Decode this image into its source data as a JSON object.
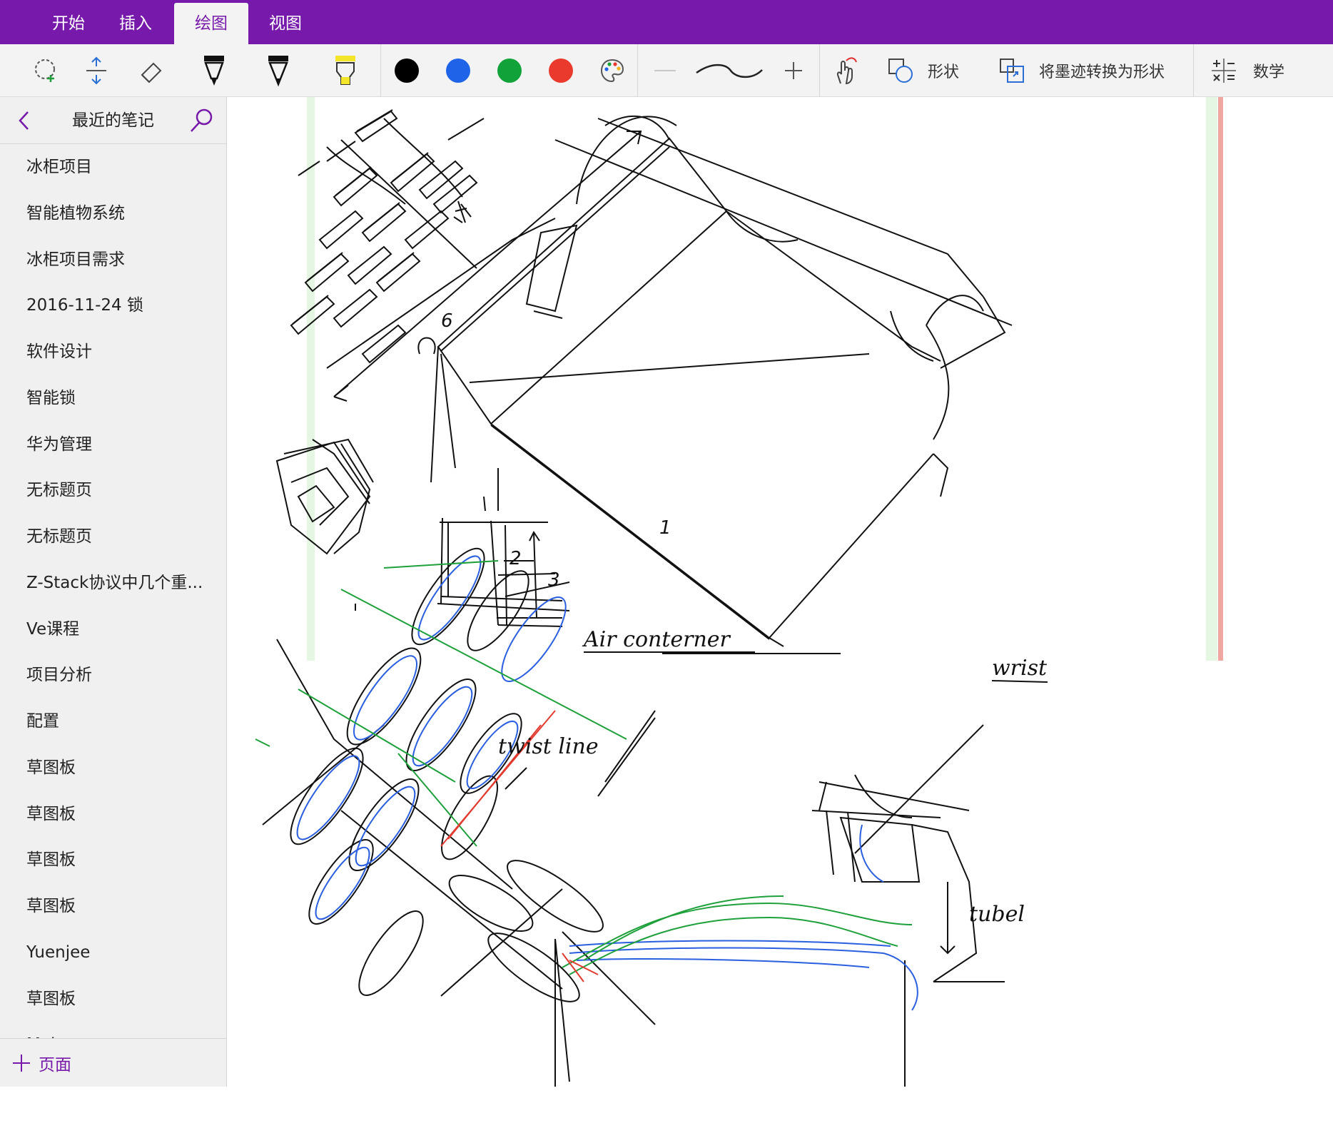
{
  "tabs": [
    {
      "label": "开始",
      "active": false
    },
    {
      "label": "插入",
      "active": false
    },
    {
      "label": "绘图",
      "active": true
    },
    {
      "label": "视图",
      "active": false
    }
  ],
  "toolbar": {
    "colors": {
      "black": "#000000",
      "blue": "#1e63e8",
      "green": "#11a33a",
      "red": "#ea3a2e"
    },
    "shapes_label": "形状",
    "ink_to_shape_label": "将墨迹转换为形状",
    "math_label": "数学"
  },
  "sidebar": {
    "title": "最近的笔记",
    "items": [
      "冰柜项目",
      "智能植物系统",
      "冰柜项目需求",
      "2016-11-24 锁",
      "软件设计",
      "智能锁",
      "华为管理",
      "无标题页",
      "无标题页",
      "Z-Stack协议中几个重...",
      "Ve课程",
      "项目分析",
      "配置",
      "草图板",
      "草图板",
      "草图板",
      "草图板",
      "Yuenjee",
      "草图板",
      "Maker"
    ],
    "add_page_label": "页面"
  },
  "annotations": {
    "num_1": "1",
    "num_2": "2",
    "num_3": "3",
    "num_6": "6",
    "air_container": "Air conterner",
    "twist_line": "twist line",
    "wrist": "wrist",
    "tubel": "tubel"
  },
  "theme": {
    "accent": "#7719aa"
  }
}
